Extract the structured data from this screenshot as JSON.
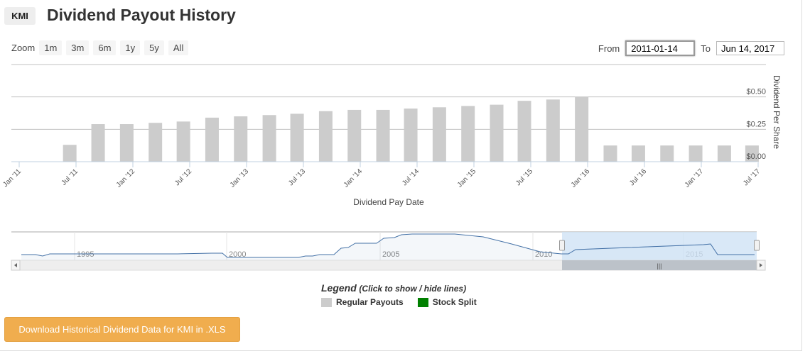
{
  "header": {
    "ticker": "KMI",
    "title": "Dividend Payout History"
  },
  "zoom": {
    "label": "Zoom",
    "buttons": [
      "1m",
      "3m",
      "6m",
      "1y",
      "5y",
      "All"
    ]
  },
  "range": {
    "from_label": "From",
    "from_value": "2011-01-14",
    "to_label": "To",
    "to_value": "Jun 14, 2017"
  },
  "chart_data": {
    "type": "bar",
    "xlabel": "Dividend Pay Date",
    "ylabel": "Dividend Per Share",
    "ylim": [
      0,
      0.75
    ],
    "yticks": [
      "$0.00",
      "$0.25",
      "$0.50"
    ],
    "ytick_values": [
      0,
      0.25,
      0.5
    ],
    "xlim": [
      "2011-01-01",
      "2017-07-01"
    ],
    "xticks": [
      "Jan '11",
      "Jul '11",
      "Jan '12",
      "Jul '12",
      "Jan '13",
      "Jul '13",
      "Jan '14",
      "Jul '14",
      "Jan '15",
      "Jul '15",
      "Jan '16",
      "Jul '16",
      "Jan '17",
      "Jul '17"
    ],
    "grid": true,
    "bar_color": "#cccccc",
    "series": [
      {
        "name": "Regular Payouts",
        "x": [
          "2011-05-16",
          "2011-08-15",
          "2011-11-15",
          "2012-02-15",
          "2012-05-15",
          "2012-08-15",
          "2012-11-15",
          "2013-02-15",
          "2013-05-15",
          "2013-08-15",
          "2013-11-15",
          "2014-02-15",
          "2014-05-15",
          "2014-08-15",
          "2014-11-15",
          "2015-02-15",
          "2015-05-15",
          "2015-08-15",
          "2015-11-15",
          "2016-02-15",
          "2016-05-15",
          "2016-08-15",
          "2016-11-15",
          "2017-02-15",
          "2017-05-15"
        ],
        "values": [
          0.13,
          0.29,
          0.29,
          0.3,
          0.31,
          0.34,
          0.35,
          0.36,
          0.37,
          0.39,
          0.4,
          0.4,
          0.41,
          0.42,
          0.43,
          0.44,
          0.47,
          0.48,
          0.5,
          0.125,
          0.125,
          0.125,
          0.125,
          0.125,
          0.125
        ]
      }
    ],
    "navigator": {
      "year_labels": [
        "1995",
        "2000",
        "2005",
        "2010",
        "2015"
      ],
      "selection": [
        "2011-01-14",
        "2017-06-14"
      ],
      "line_color": "#4572a7",
      "mask_color": "#d0e2f5"
    }
  },
  "legend": {
    "title": "Legend",
    "subtitle": "(Click to show / hide lines)",
    "items": [
      {
        "label": "Regular Payouts",
        "color": "#cccccc"
      },
      {
        "label": "Stock Split",
        "color": "#008000"
      }
    ]
  },
  "download": {
    "label": "Download Historical Dividend Data for KMI in .XLS"
  }
}
